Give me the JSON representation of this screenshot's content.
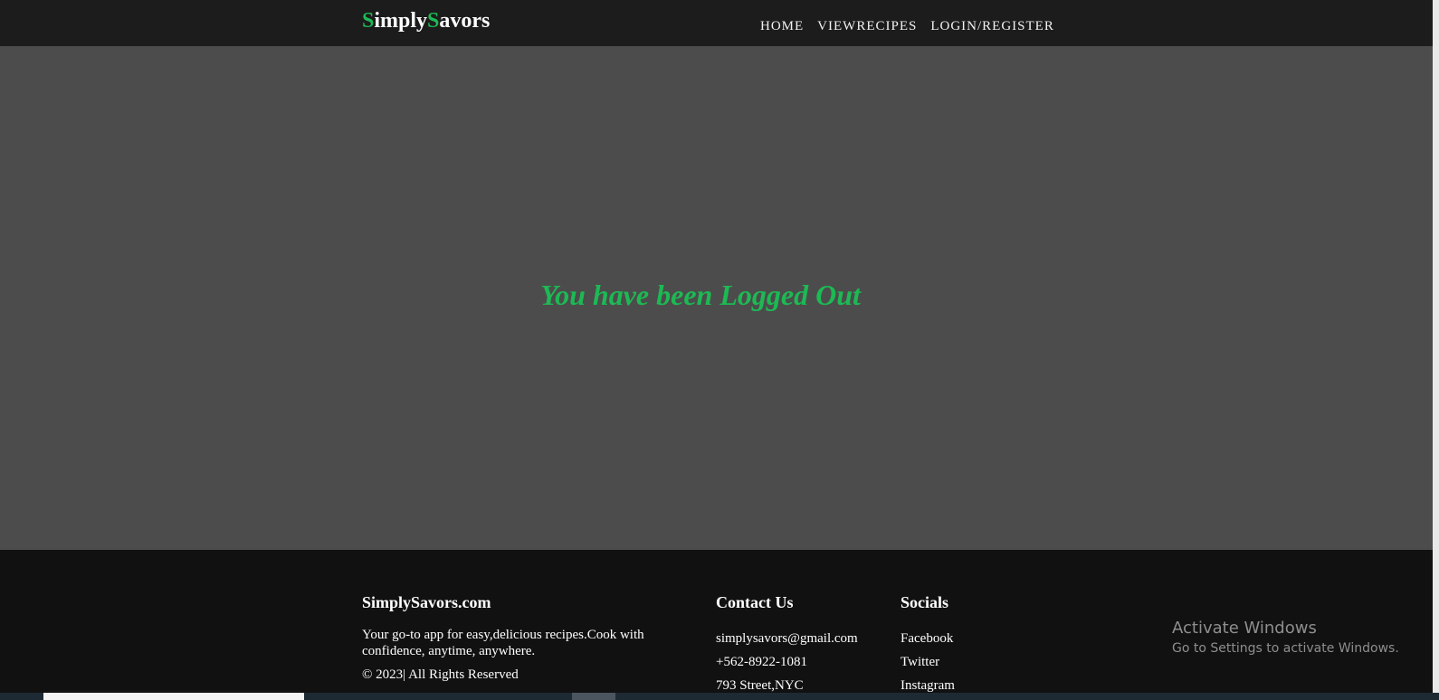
{
  "nav": {
    "logo": {
      "first_initial": "S",
      "first_rest": "imply",
      "second_initial": "S",
      "second_rest": "avors"
    },
    "links": [
      "HOME",
      "VIEWRECIPES",
      "LOGIN/REGISTER"
    ]
  },
  "main": {
    "message": "You have been Logged Out"
  },
  "footer": {
    "about": {
      "heading": "SimplySavors.com",
      "description": "Your go-to app for easy,delicious recipes.Cook with confidence, anytime, anywhere.",
      "copyright": "© 2023| All Rights Reserved"
    },
    "contact": {
      "heading": "Contact Us",
      "email": "simplysavors@gmail.com",
      "phone": "+562-8922-1081",
      "address": "793 Street,NYC"
    },
    "socials": {
      "heading": "Socials",
      "links": [
        "Facebook",
        "Twitter",
        "Instagram"
      ]
    }
  },
  "watermark": {
    "title": "Activate Windows",
    "subtitle": "Go to Settings to activate Windows."
  },
  "colors": {
    "accent": "#1db954",
    "navbar_bg": "#1c1c1c",
    "main_bg": "#4c4c4c",
    "footer_bg": "#111111"
  }
}
